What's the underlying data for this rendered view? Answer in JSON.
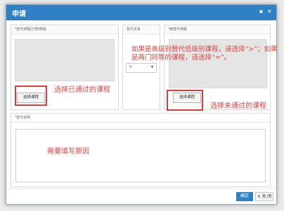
{
  "dialog": {
    "title": "申请",
    "maximize_icon": "maximize-icon",
    "close_icon": "close-icon"
  },
  "left_panel": {
    "header": "*替代课程(已修课程)",
    "button": "选择课程",
    "note": "选择已通过的课程"
  },
  "middle_panel": {
    "header": "替代关系",
    "select_value": ">",
    "select_icon": "chevron-down-icon"
  },
  "right_panel": {
    "header": "*被替代课程",
    "button": "选择课程",
    "note": "选择未通过的课程"
  },
  "top_note_line1": "如果是高级别替代低级别课程，请选择“>”；如果",
  "top_note_line2": "是两门同等的课程，请选择“=”。",
  "reason_panel": {
    "header": "*替代说明",
    "note": "需要填写原因"
  },
  "footer": {
    "confirm": "确定",
    "close": "关 闭",
    "close_icon": "close-icon"
  },
  "colors": {
    "titlebar": "#2f80c4",
    "annotation": "#e04040",
    "confirm": "#2f80c4"
  }
}
